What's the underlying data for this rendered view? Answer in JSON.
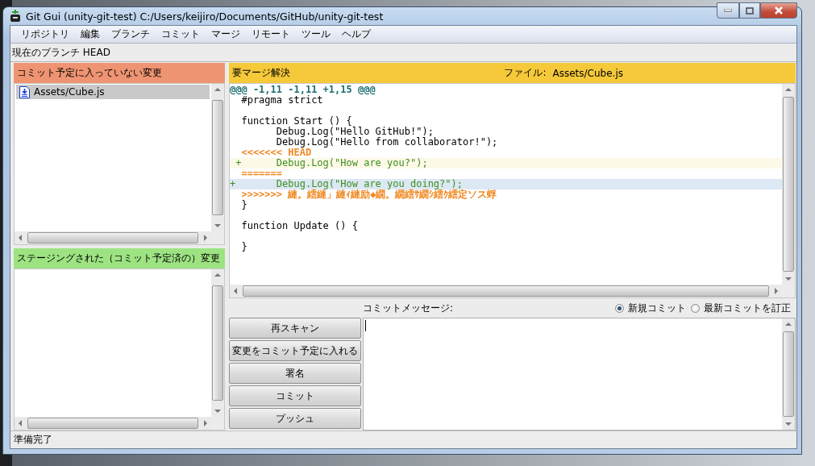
{
  "window": {
    "title": "Git Gui (unity-git-test) C:/Users/keijiro/Documents/GitHub/unity-git-test"
  },
  "menu": [
    "リポジトリ",
    "編集",
    "ブランチ",
    "コミット",
    "マージ",
    "リモート",
    "ツール",
    "ヘルプ"
  ],
  "branch_label": "現在のブランチ HEAD",
  "unstaged": {
    "title": "コミット予定に入っていない変更",
    "files": [
      {
        "name": "Assets/Cube.js",
        "selected": true
      }
    ]
  },
  "staged": {
    "title": "ステージングされた（コミット予定済の）変更"
  },
  "diff": {
    "status": "要マージ解決",
    "file_label": "ファイル:",
    "file": "Assets/Cube.js",
    "lines": [
      {
        "kind": "hunk",
        "text": "@@@ -1,11 -1,11 +1,15 @@@"
      },
      {
        "kind": "context",
        "text": "  #pragma strict"
      },
      {
        "kind": "blank"
      },
      {
        "kind": "context",
        "text": "  function Start () {"
      },
      {
        "kind": "context",
        "text": "        Debug.Log(\"Hello GitHub!\");"
      },
      {
        "kind": "context",
        "text": "        Debug.Log(\"Hello from collaborator!\");"
      },
      {
        "kind": "marker",
        "text": "  <<<<<<< HEAD"
      },
      {
        "kind": "ours",
        "text": " +      Debug.Log(\"How are you?\");"
      },
      {
        "kind": "marker",
        "text": "  ======="
      },
      {
        "kind": "theirs",
        "text": "+       Debug.Log(\"How are you doing?\");"
      },
      {
        "kind": "marker",
        "text": "  >>>>>>> 縺。繧縺」縺ｨ縺励◆繝。繝繧ｻ繝ｼ繧ｸ繧定ソス蜉"
      },
      {
        "kind": "context",
        "text": "  }"
      },
      {
        "kind": "blank"
      },
      {
        "kind": "context",
        "text": "  function Update () {"
      },
      {
        "kind": "blank"
      },
      {
        "kind": "context",
        "text": "  }"
      }
    ]
  },
  "commit": {
    "label": "コミットメッセージ:",
    "modes": [
      {
        "label": "新規コミット",
        "selected": true
      },
      {
        "label": "最新コミットを訂正",
        "selected": false
      }
    ],
    "buttons": [
      "再スキャン",
      "変更をコミット予定に入れる",
      "署名",
      "コミット",
      "プッシュ"
    ]
  },
  "status_bar": "準備完了"
}
